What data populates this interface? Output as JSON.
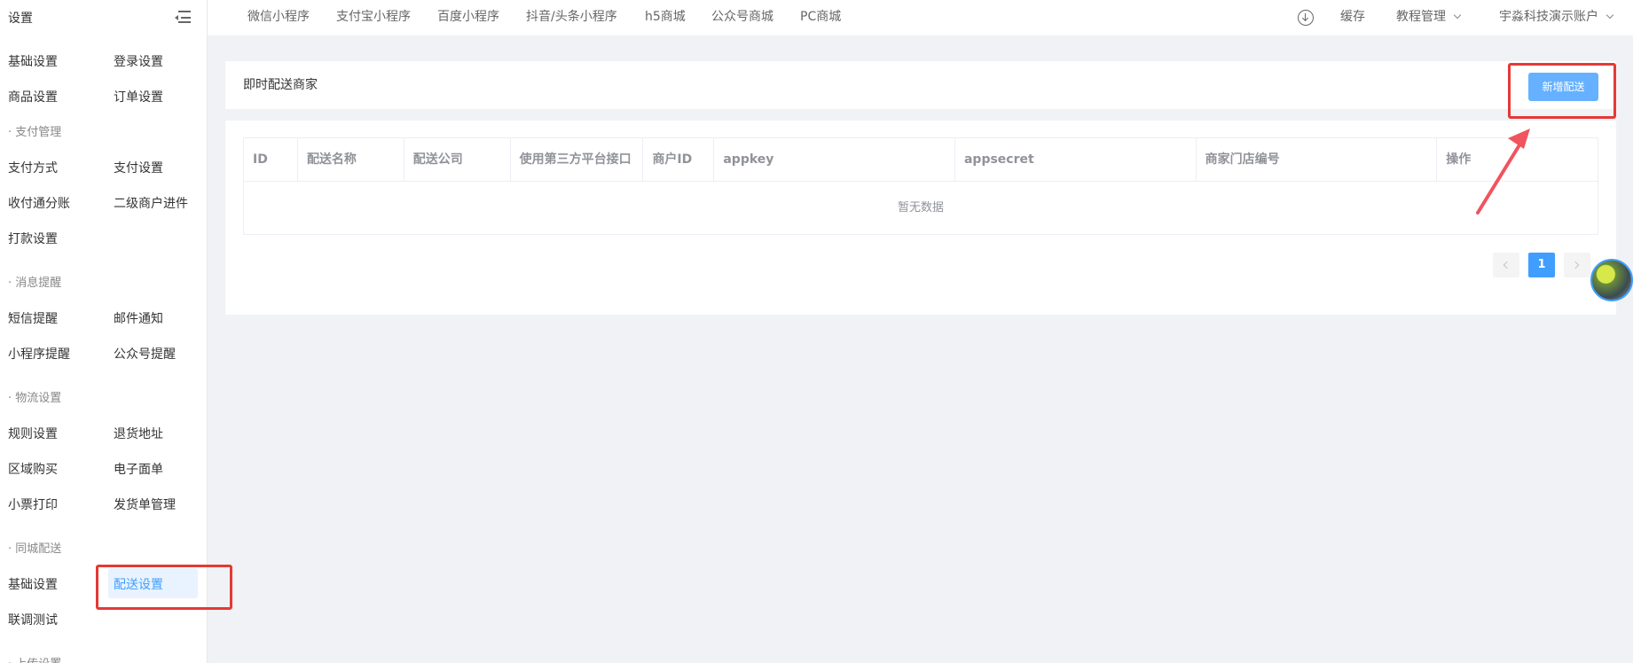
{
  "sidebar": {
    "title": "设置",
    "rows": [
      {
        "c1": "基础设置",
        "c2": "登录设置"
      },
      {
        "c1": "商品设置",
        "c2": "订单设置"
      },
      {
        "c1": "支付方式",
        "c2": "支付设置"
      },
      {
        "c1": "收付通分账",
        "c2": "二级商户进件"
      },
      {
        "c1": "打款设置",
        "c2": ""
      },
      {
        "c1": "短信提醒",
        "c2": "邮件通知"
      },
      {
        "c1": "小程序提醒",
        "c2": "公众号提醒"
      },
      {
        "c1": "规则设置",
        "c2": "退货地址"
      },
      {
        "c1": "区域购买",
        "c2": "电子面单"
      },
      {
        "c1": "小票打印",
        "c2": "发货单管理"
      },
      {
        "c1": "基础设置",
        "c2": "配送设置"
      },
      {
        "c1": "联调测试",
        "c2": ""
      }
    ],
    "groups": [
      "· 支付管理",
      "· 消息提醒",
      "· 物流设置",
      "· 同城配送",
      "· 上传设置"
    ]
  },
  "topnav": {
    "items": [
      "微信小程序",
      "支付宝小程序",
      "百度小程序",
      "抖音/头条小程序",
      "h5商城",
      "公众号商城",
      "PC商城"
    ],
    "cache": "缓存",
    "tutorial": "教程管理",
    "account": "宇淼科技演示账户"
  },
  "page": {
    "title": "即时配送商家",
    "add_button": "新增配送"
  },
  "table": {
    "columns": [
      "ID",
      "配送名称",
      "配送公司",
      "使用第三方平台接口",
      "商户ID",
      "appkey",
      "appsecret",
      "商家门店编号",
      "操作"
    ],
    "empty_text": "暂无数据"
  },
  "pagination": {
    "current_page": "1"
  },
  "colors": {
    "accent": "#409eff",
    "button": "#66b1ff",
    "highlight": "#e53935"
  }
}
